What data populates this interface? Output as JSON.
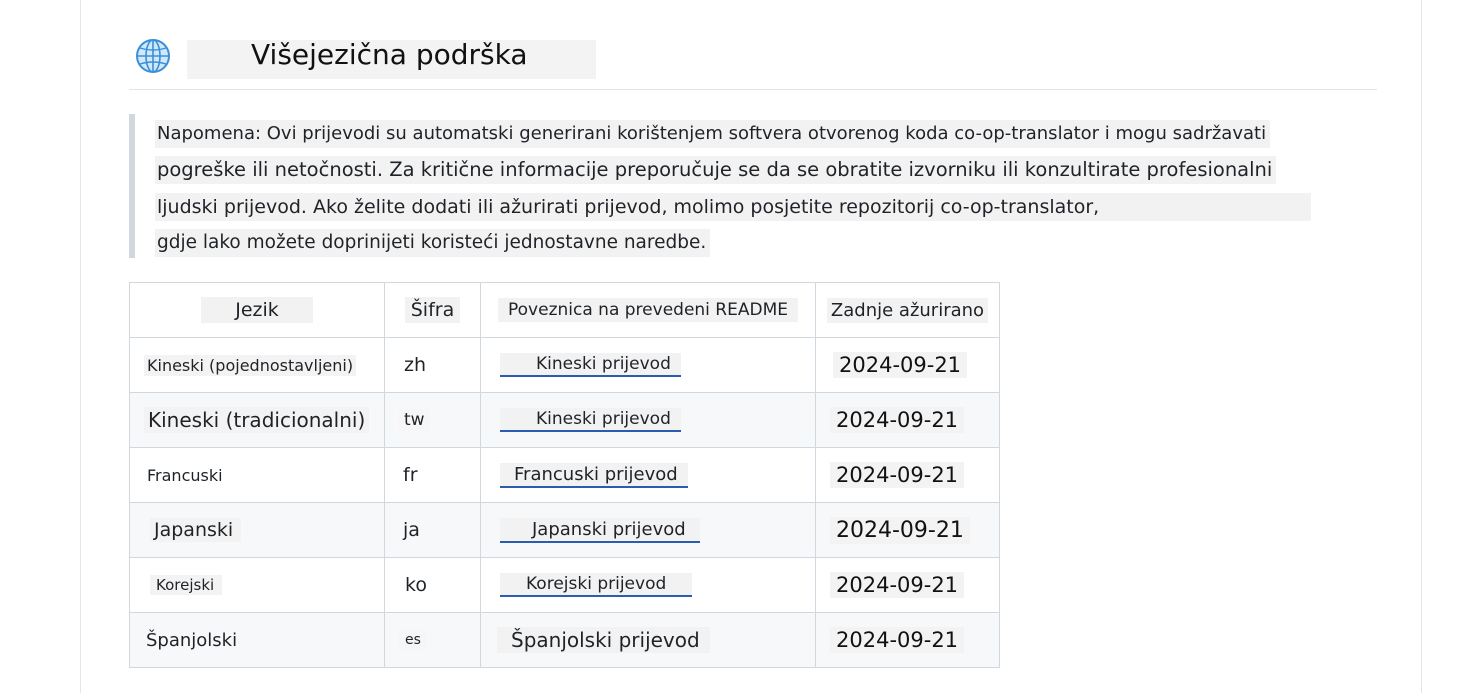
{
  "header": {
    "icon": "globe-icon",
    "title": "Višejezična podrška"
  },
  "note": {
    "lines": [
      "Napomena: Ovi prijevodi su automatski generirani korištenjem softvera otvorenog koda co-op-translator i mogu sadržavati",
      "pogreške ili netočnosti. Za kritične informacije preporučuje se da se obratite izvorniku ili konzultirate profesionalni",
      "ljudski prijevod. Ako želite dodati ili ažurirati prijevod, molimo posjetite repozitorij co-op-translator,",
      "gdje lako možete doprinijeti koristeći jednostavne naredbe."
    ]
  },
  "table": {
    "headers": [
      "Jezik",
      "Šifra",
      "Poveznica na prevedeni README",
      "Zadnje ažurirano"
    ],
    "rows": [
      {
        "language": "Kineski (pojednostavljeni)",
        "code": "zh",
        "link": "Kineski prijevod",
        "updated": "2024-09-21"
      },
      {
        "language": "Kineski (tradicionalni)",
        "code": "tw",
        "link": "Kineski prijevod",
        "updated": "2024-09-21"
      },
      {
        "language": "Francuski",
        "code": "fr",
        "link": "Francuski prijevod",
        "updated": "2024-09-21"
      },
      {
        "language": "Japanski",
        "code": "ja",
        "link": "Japanski prijevod",
        "updated": "2024-09-21"
      },
      {
        "language": "Korejski",
        "code": "ko",
        "link": "Korejski prijevod",
        "updated": "2024-09-21"
      },
      {
        "language": "Španjolski",
        "code": "es",
        "link": "Španjolski prijevod",
        "updated": "2024-09-21"
      }
    ]
  },
  "colors": {
    "link_underline": "#2a5db0",
    "quote_bar": "#d0d7de",
    "alt_row": "#f6f8fa"
  }
}
